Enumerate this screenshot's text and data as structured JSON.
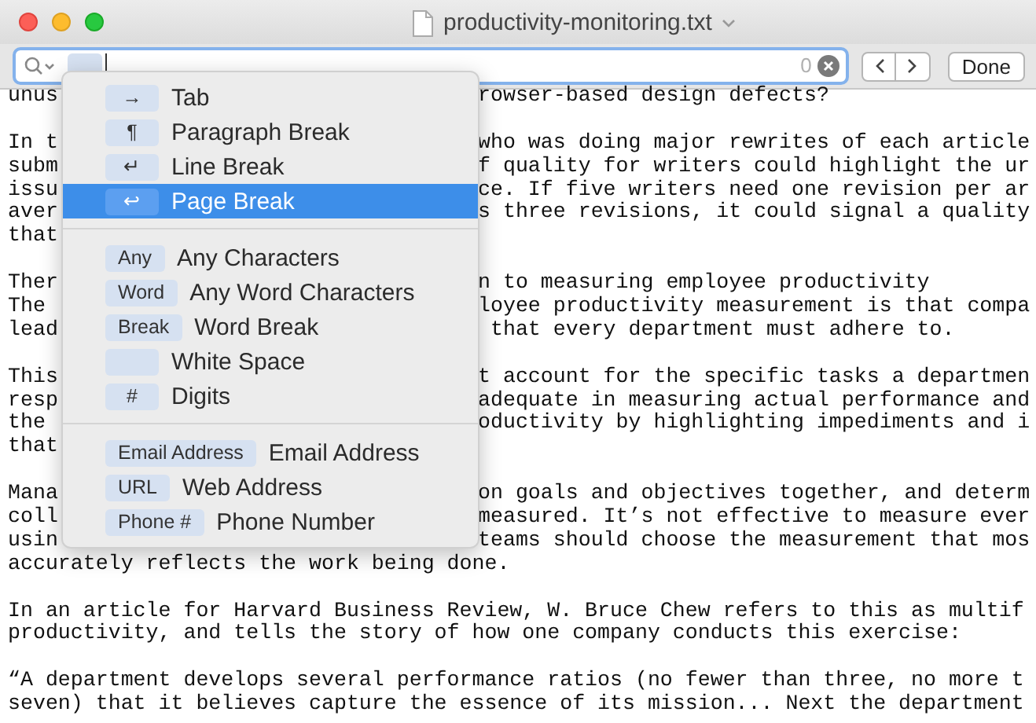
{
  "window": {
    "title": "productivity-monitoring.txt"
  },
  "find_bar": {
    "match_count": "0",
    "buttons": [
      "Done"
    ]
  },
  "document": {
    "rows": [
      {
        "kind": "split",
        "left": "unus",
        "right": "rowser-based design defects?"
      },
      {
        "kind": "blank"
      },
      {
        "kind": "split",
        "left": "In t",
        "right": "who was doing major rewrites of each article"
      },
      {
        "kind": "split",
        "left": "subm",
        "right": "f quality for writers could highlight the ur"
      },
      {
        "kind": "split",
        "left": "issu",
        "right": "ce. If five writers need one revision per ar"
      },
      {
        "kind": "split",
        "left": "aver",
        "right": "s three revisions, it could signal a quality"
      },
      {
        "kind": "split",
        "left": "that"
      },
      {
        "kind": "blank"
      },
      {
        "kind": "split",
        "left": "Ther",
        "right": "n to measuring employee productivity"
      },
      {
        "kind": "split",
        "left": "The",
        "right": "loyee productivity measurement is that compa"
      },
      {
        "kind": "split",
        "left": "lead",
        "right": " that every department must adhere to."
      },
      {
        "kind": "blank"
      },
      {
        "kind": "split",
        "left": "This",
        "right": "t account for the specific tasks a departmen"
      },
      {
        "kind": "split",
        "left": "resp",
        "right": "adequate in measuring actual performance and"
      },
      {
        "kind": "split",
        "left": "the",
        "right": "oductivity by highlighting impediments and i"
      },
      {
        "kind": "split",
        "left": "that"
      },
      {
        "kind": "blank"
      },
      {
        "kind": "split",
        "left": "Mana",
        "right": "on goals and objectives together, and determ"
      },
      {
        "kind": "split",
        "left": "coll",
        "right": "measured. It’s not effective to measure ever"
      },
      {
        "kind": "split",
        "left": "usin",
        "right": "teams should choose the measurement that mos"
      },
      {
        "kind": "line",
        "text": "accurately reflects the work being done."
      },
      {
        "kind": "blank"
      },
      {
        "kind": "line",
        "text": "In an article for Harvard Business Review, W. Bruce Chew refers to this as multif"
      },
      {
        "kind": "line",
        "text": "productivity, and tells the story of how one company conducts this exercise:"
      },
      {
        "kind": "blank"
      },
      {
        "kind": "line",
        "text": "“A department develops several performance ratios (no fewer than three, no more t"
      },
      {
        "kind": "line",
        "text": "seven) that it believes capture the essence of its mission... Next the department"
      }
    ]
  },
  "menu": {
    "sections": [
      {
        "items": [
          {
            "token": "→",
            "label": "Tab",
            "selected": false
          },
          {
            "token": "¶",
            "label": "Paragraph Break",
            "selected": false
          },
          {
            "token": "↵",
            "label": "Line Break",
            "selected": false
          },
          {
            "token": "↩",
            "label": "Page Break",
            "selected": true
          }
        ]
      },
      {
        "items": [
          {
            "token": "Any",
            "label": "Any Characters",
            "selected": false
          },
          {
            "token": "Word",
            "label": "Any Word Characters",
            "selected": false
          },
          {
            "token": "Break",
            "label": "Word Break",
            "selected": false
          },
          {
            "label": "White Space",
            "selected": false
          },
          {
            "token": "#",
            "label": "Digits",
            "selected": false
          }
        ]
      },
      {
        "items": [
          {
            "token": "Email Address",
            "label": "Email Address",
            "selected": false
          },
          {
            "token": "URL",
            "label": "Web Address",
            "selected": false
          },
          {
            "token": "Phone #",
            "label": "Phone Number",
            "selected": false
          }
        ]
      }
    ]
  }
}
